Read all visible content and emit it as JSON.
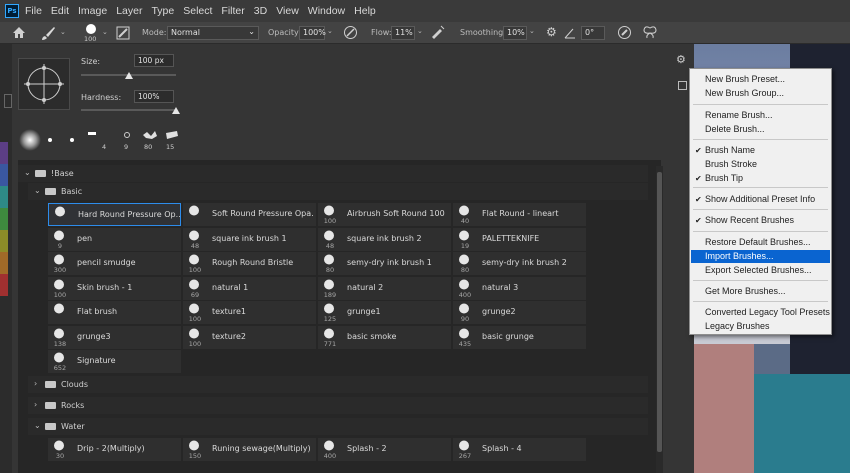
{
  "menubar": {
    "logo": "Ps",
    "items": [
      "File",
      "Edit",
      "Image",
      "Layer",
      "Type",
      "Select",
      "Filter",
      "3D",
      "View",
      "Window",
      "Help"
    ]
  },
  "options": {
    "brush_size": "100",
    "mode_label": "Mode:",
    "mode_value": "Normal",
    "opacity_label": "Opacity:",
    "opacity_value": "100%",
    "flow_label": "Flow:",
    "flow_value": "11%",
    "smoothing_label": "Smoothing:",
    "smoothing_value": "10%",
    "angle_value": "0°"
  },
  "panel": {
    "size_label": "Size:",
    "size_value": "100 px",
    "size_fraction": 0.5,
    "hardness_label": "Hardness:",
    "hardness_value": "100%",
    "hardness_fraction": 1.0,
    "recent_sizes": [
      "",
      "",
      "",
      "4",
      "9",
      "80",
      "15"
    ]
  },
  "groups": {
    "base": "!Base",
    "basic": "Basic",
    "clouds": "Clouds",
    "rocks": "Rocks",
    "water": "Water"
  },
  "basic_rows": [
    [
      {
        "name": "Hard Round Pressure Op...",
        "num": ""
      },
      {
        "name": "Soft Round Pressure Opa...",
        "num": ""
      },
      {
        "name": "Airbrush Soft Round 100",
        "num": "100"
      },
      {
        "name": "Flat Round - lineart",
        "num": "40"
      }
    ],
    [
      {
        "name": "pen",
        "num": "9"
      },
      {
        "name": "square ink brush 1",
        "num": "48"
      },
      {
        "name": "square ink brush 2",
        "num": "48"
      },
      {
        "name": "PALETTEKNIFE",
        "num": "19"
      }
    ],
    [
      {
        "name": "pencil smudge",
        "num": "300"
      },
      {
        "name": "Rough Round Bristle",
        "num": "100"
      },
      {
        "name": "semy-dry ink brush 1",
        "num": "80"
      },
      {
        "name": "semy-dry ink brush 2",
        "num": "80"
      }
    ],
    [
      {
        "name": "Skin brush - 1",
        "num": "100"
      },
      {
        "name": "natural 1",
        "num": "69"
      },
      {
        "name": "natural 2",
        "num": "189"
      },
      {
        "name": "natural 3",
        "num": "400"
      }
    ],
    [
      {
        "name": "Flat brush",
        "num": ""
      },
      {
        "name": "texture1",
        "num": "100"
      },
      {
        "name": "grunge1",
        "num": "125"
      },
      {
        "name": "grunge2",
        "num": "90"
      }
    ],
    [
      {
        "name": "grunge3",
        "num": "138"
      },
      {
        "name": "texture2",
        "num": "100"
      },
      {
        "name": "basic smoke",
        "num": "771"
      },
      {
        "name": "basic grunge",
        "num": "435"
      }
    ],
    [
      {
        "name": "Signature",
        "num": "652"
      }
    ]
  ],
  "water_rows": [
    [
      {
        "name": "Drip - 2(Multiply)",
        "num": "30"
      },
      {
        "name": "Runing sewage(Multiply)",
        "num": "150"
      },
      {
        "name": "Splash - 2",
        "num": "400"
      },
      {
        "name": "Splash - 4",
        "num": "267"
      }
    ]
  ],
  "menu": {
    "items": [
      {
        "label": "New Brush Preset...",
        "checked": false,
        "highlighted": false
      },
      {
        "label": "New Brush Group...",
        "checked": false,
        "highlighted": false
      },
      {
        "label": "Rename Brush...",
        "checked": false,
        "highlighted": false
      },
      {
        "label": "Delete Brush...",
        "checked": false,
        "highlighted": false
      },
      {
        "label": "Brush Name",
        "checked": true,
        "highlighted": false
      },
      {
        "label": "Brush Stroke",
        "checked": false,
        "highlighted": false
      },
      {
        "label": "Brush Tip",
        "checked": true,
        "highlighted": false
      },
      {
        "label": "Show Additional Preset Info",
        "checked": true,
        "highlighted": false
      },
      {
        "label": "Show Recent Brushes",
        "checked": true,
        "highlighted": false
      },
      {
        "label": "Restore Default Brushes...",
        "checked": false,
        "highlighted": false
      },
      {
        "label": "Import Brushes...",
        "checked": false,
        "highlighted": true
      },
      {
        "label": "Export Selected Brushes...",
        "checked": false,
        "highlighted": false
      },
      {
        "label": "Get More Brushes...",
        "checked": false,
        "highlighted": false
      },
      {
        "label": "Converted Legacy Tool Presets",
        "checked": false,
        "highlighted": false
      },
      {
        "label": "Legacy Brushes",
        "checked": false,
        "highlighted": false
      }
    ]
  },
  "colors": {
    "highlight": "#0a64d0",
    "selection_border": "#2d8ceb"
  }
}
